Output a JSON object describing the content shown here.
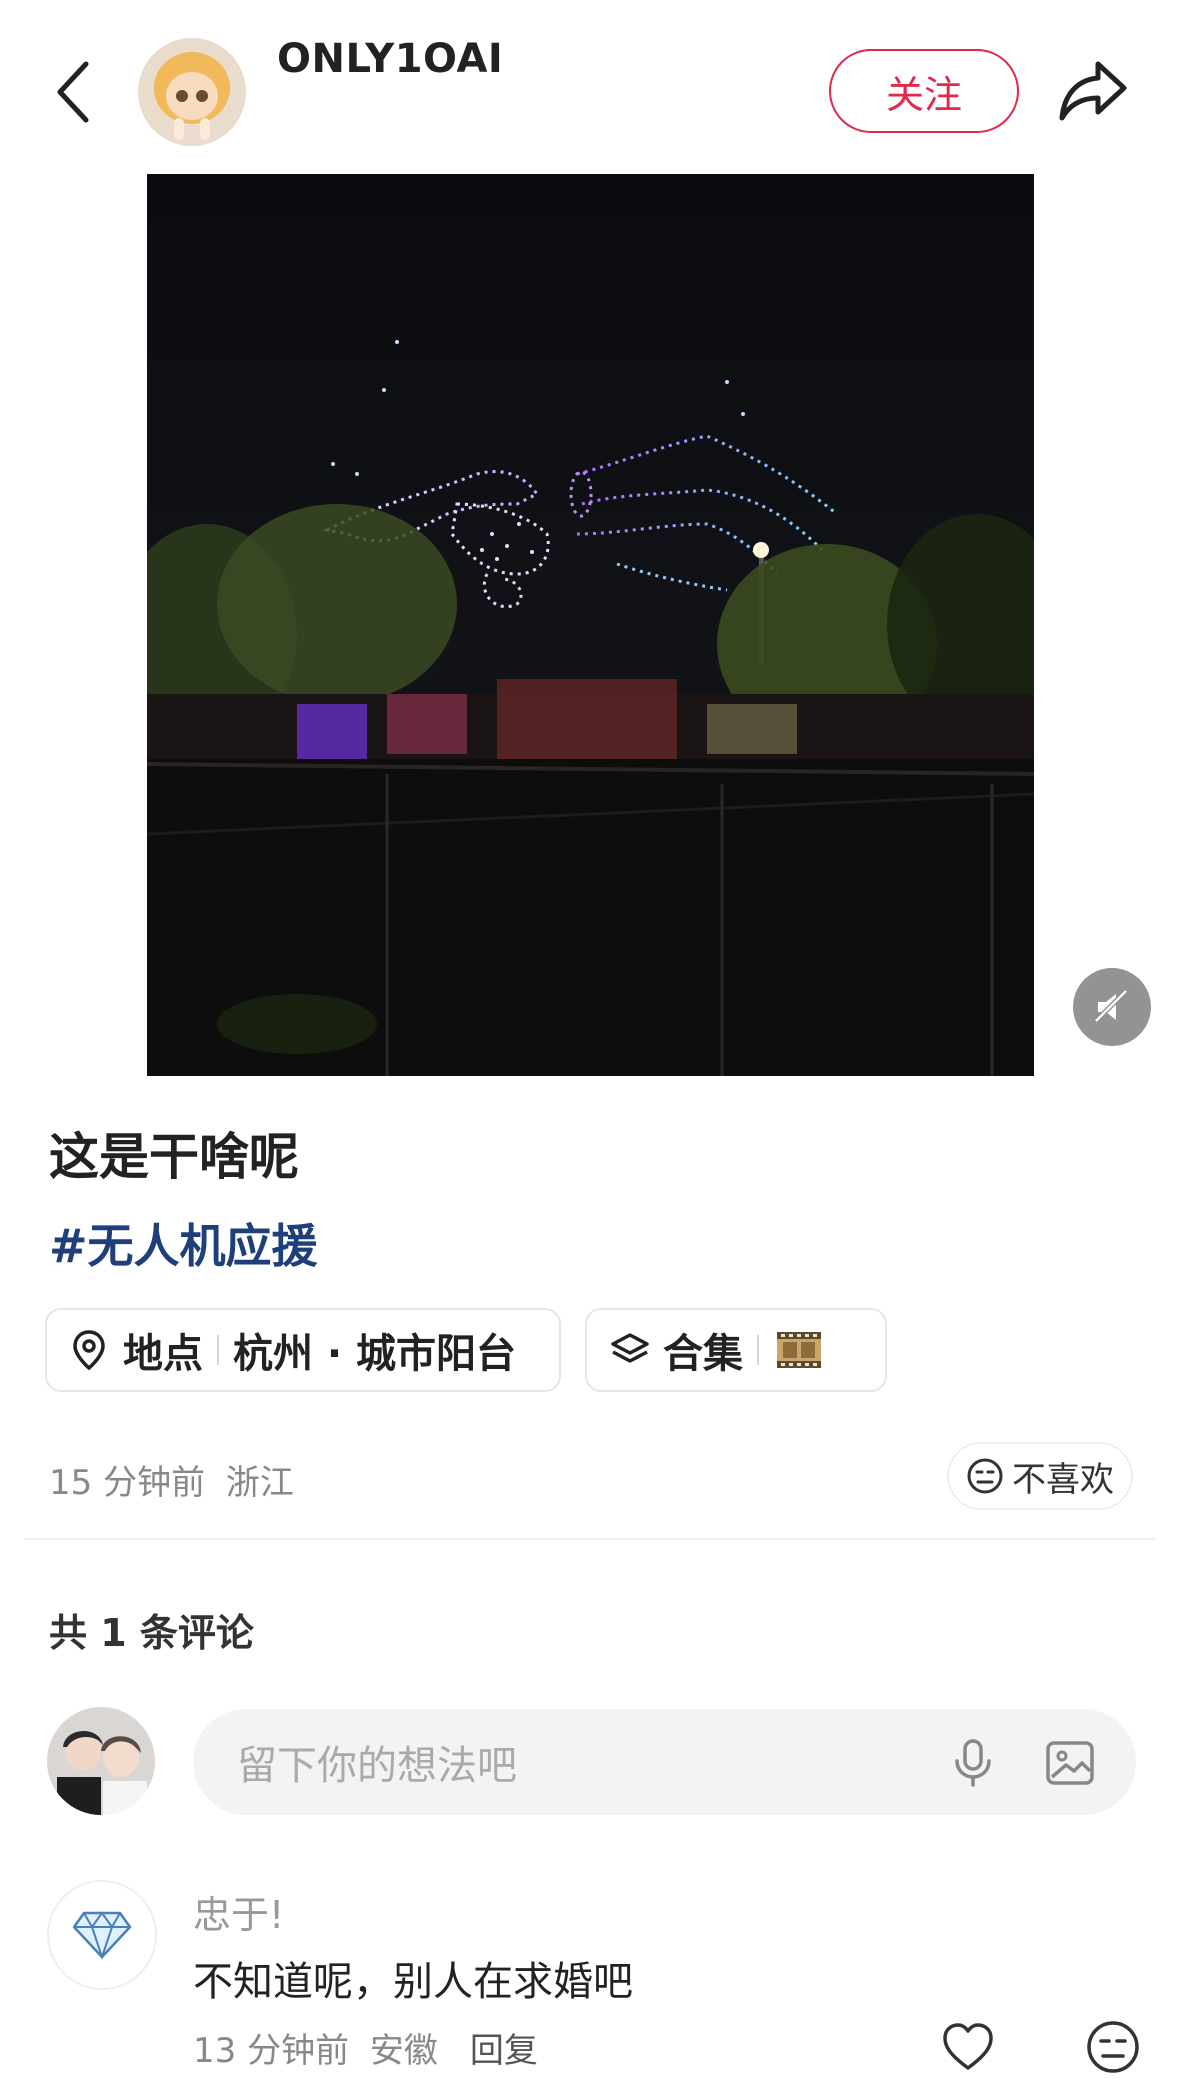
{
  "header": {
    "username": "ONLY1OAI",
    "follow_label": "关注"
  },
  "post": {
    "title": "这是干啥呢",
    "hashtag": "#无人机应援",
    "location_label": "地点",
    "location_value": "杭州 · 城市阳台",
    "collection_label": "合集",
    "time": "15 分钟前",
    "region": "浙江",
    "dislike_label": "不喜欢"
  },
  "comments_section": {
    "count_label": "共 1 条评论",
    "input_placeholder": "留下你的想法吧"
  },
  "comments": [
    {
      "name": "忠于!",
      "text": "不知道呢，别人在求婚吧",
      "time": "13 分钟前",
      "region": "安徽",
      "reply_label": "回复"
    }
  ],
  "colors": {
    "accent": "#e0294b",
    "hashtag": "#1e3f7a",
    "muted": "#888888"
  }
}
